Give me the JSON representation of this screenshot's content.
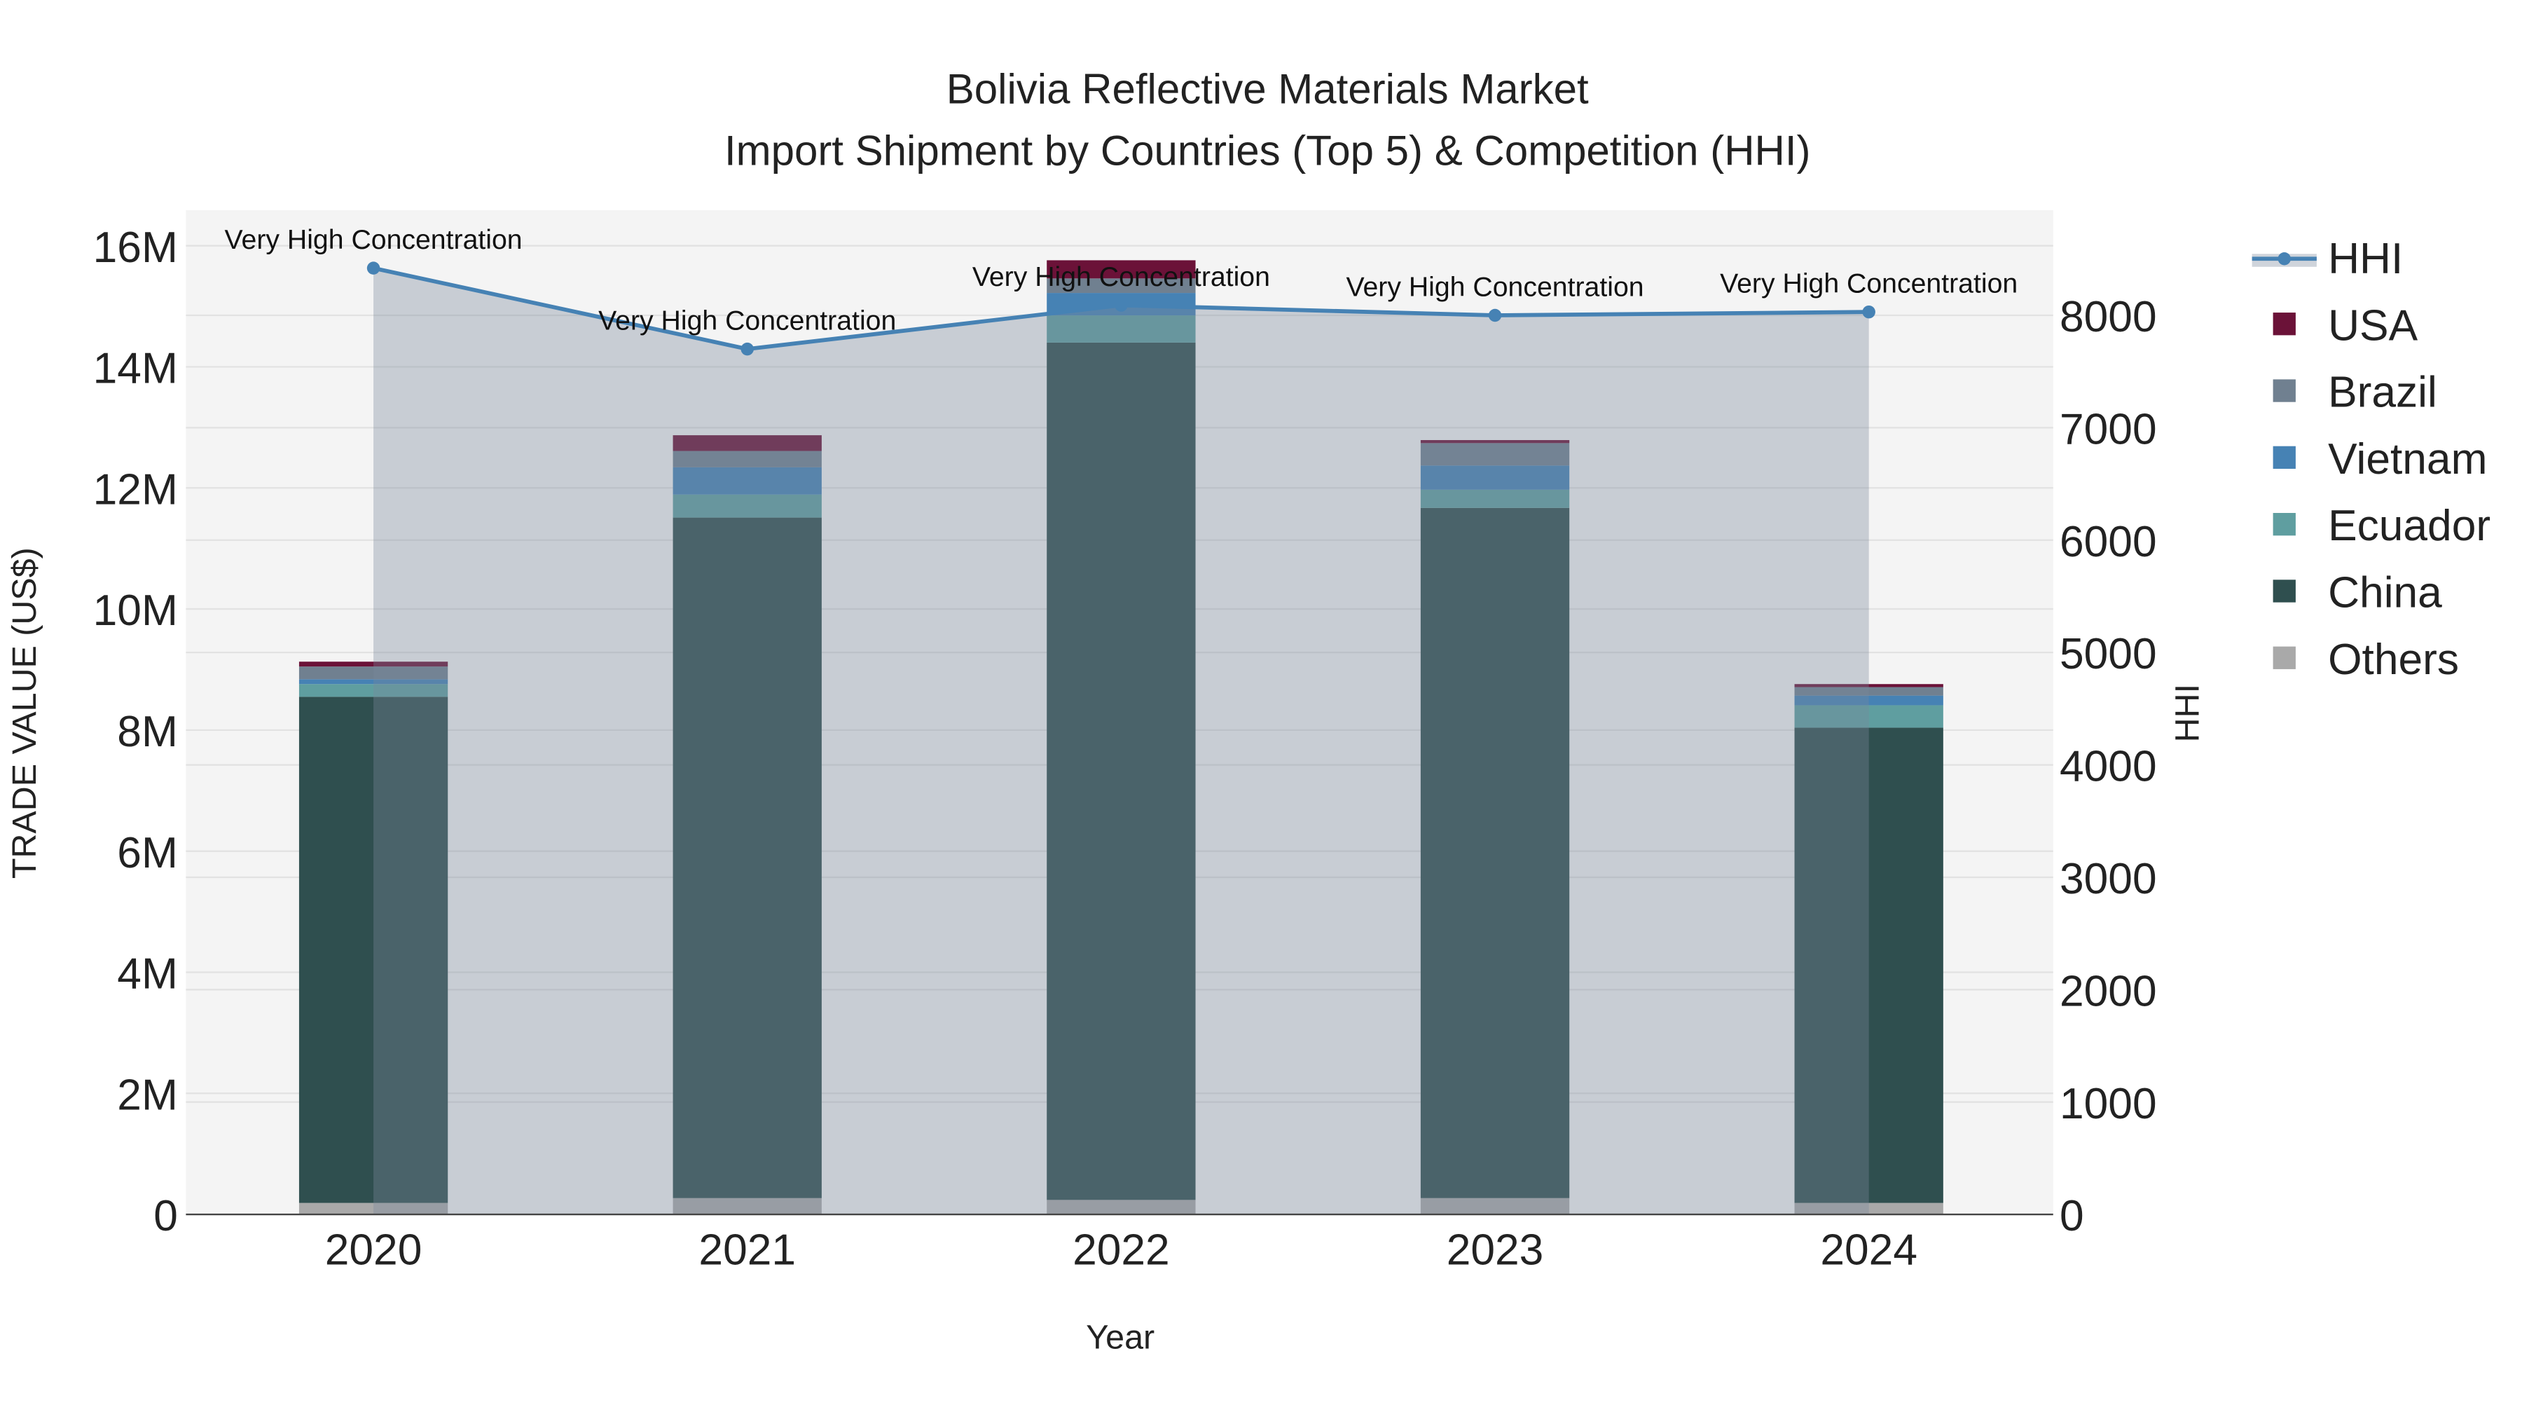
{
  "chart_data": {
    "type": "bar",
    "title": "Bolivia Reflective Materials Market",
    "subtitle": "Import Shipment by Countries (Top 5) & Competition (HHI)",
    "xlabel": "Year",
    "ylabel": "TRADE VALUE (US$)",
    "y2label": "HHI",
    "categories": [
      "2020",
      "2021",
      "2022",
      "2023",
      "2024"
    ],
    "ylim": [
      0,
      16500000
    ],
    "y_ticks": [
      0,
      2000000,
      4000000,
      6000000,
      8000000,
      10000000,
      12000000,
      14000000,
      16000000
    ],
    "y_tick_labels": [
      "0",
      "2M",
      "4M",
      "6M",
      "8M",
      "10M",
      "12M",
      "14M",
      "16M"
    ],
    "y2lim": [
      0,
      8900
    ],
    "y2_ticks": [
      0,
      1000,
      2000,
      3000,
      4000,
      5000,
      6000,
      7000,
      8000
    ],
    "y2_tick_labels": [
      "0",
      "1000",
      "2000",
      "3000",
      "4000",
      "5000",
      "6000",
      "7000",
      "8000"
    ],
    "stacked": true,
    "grid": true,
    "legend_placement": "right",
    "series": [
      {
        "name": "Others",
        "color": "#a9a9a9",
        "values": [
          190000,
          270000,
          240000,
          270000,
          190000
        ]
      },
      {
        "name": "China",
        "color": "#2f4f4f",
        "values": [
          8360000,
          11240000,
          14160000,
          11400000,
          7850000
        ]
      },
      {
        "name": "Ecuador",
        "color": "#5f9ea0",
        "values": [
          210000,
          380000,
          450000,
          300000,
          370000
        ]
      },
      {
        "name": "Vietnam",
        "color": "#4682b4",
        "values": [
          80000,
          450000,
          370000,
          400000,
          160000
        ]
      },
      {
        "name": "Brazil",
        "color": "#708090",
        "values": [
          210000,
          270000,
          240000,
          370000,
          140000
        ]
      },
      {
        "name": "USA",
        "color": "#6b1238",
        "values": [
          80000,
          260000,
          300000,
          50000,
          50000
        ]
      }
    ],
    "line_series": {
      "name": "HHI",
      "color": "#4682b4",
      "axis": "right",
      "fill": "tozeroy",
      "values": [
        8420,
        7700,
        8090,
        8000,
        8030
      ],
      "annotations": [
        "Very High Concentration",
        "Very High Concentration",
        "Very High Concentration",
        "Very High Concentration",
        "Very High Concentration"
      ]
    },
    "legend_order": [
      "HHI",
      "USA",
      "Brazil",
      "Vietnam",
      "Ecuador",
      "China",
      "Others"
    ]
  }
}
